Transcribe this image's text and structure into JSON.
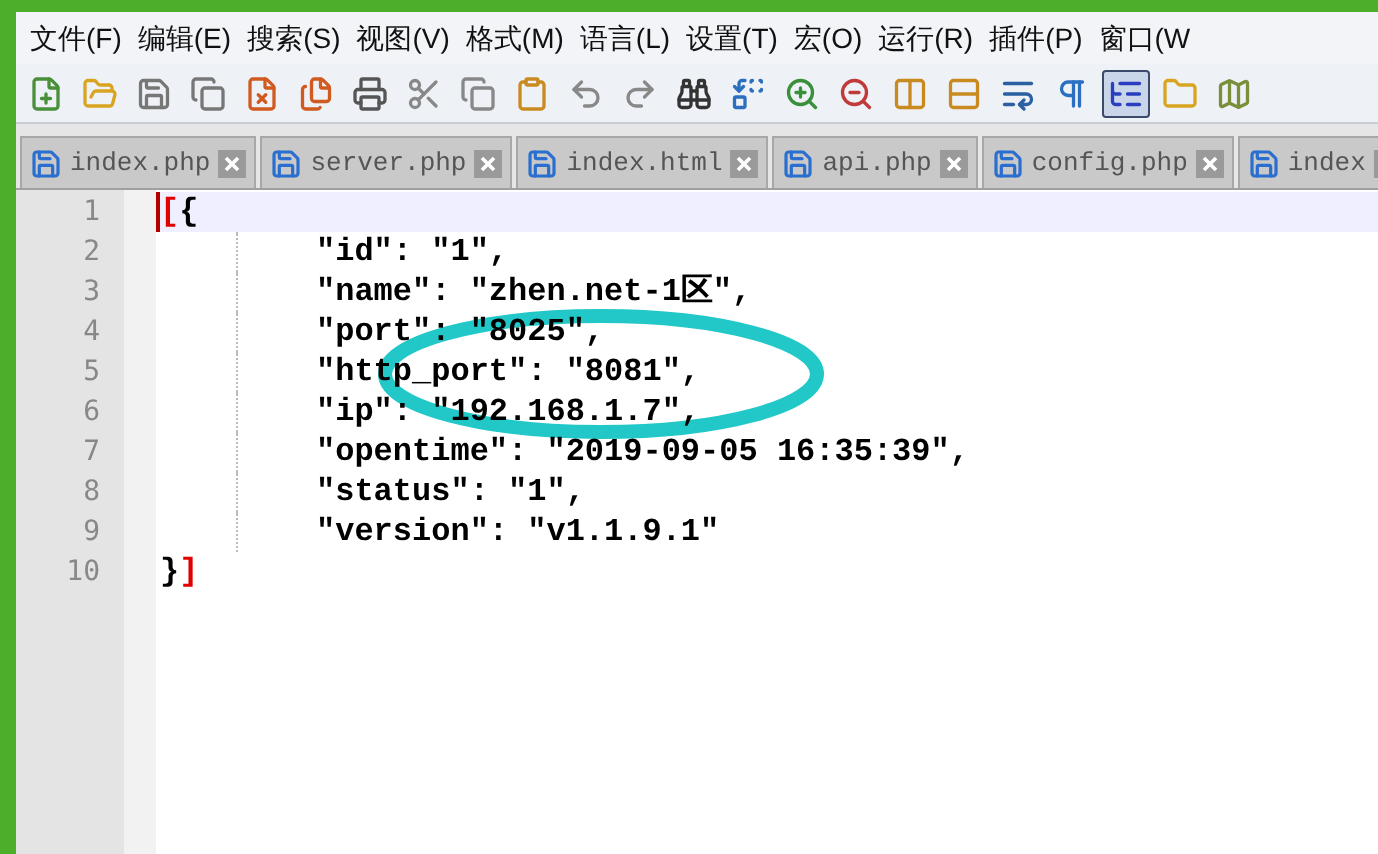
{
  "menu": [
    {
      "label": "文件(F)"
    },
    {
      "label": "编辑(E)"
    },
    {
      "label": "搜索(S)"
    },
    {
      "label": "视图(V)"
    },
    {
      "label": "格式(M)"
    },
    {
      "label": "语言(L)"
    },
    {
      "label": "设置(T)"
    },
    {
      "label": "宏(O)"
    },
    {
      "label": "运行(R)"
    },
    {
      "label": "插件(P)"
    },
    {
      "label": "窗口(W"
    }
  ],
  "toolbar": [
    {
      "kind": "new",
      "selected": false
    },
    {
      "kind": "open",
      "selected": false
    },
    {
      "kind": "save",
      "selected": false
    },
    {
      "kind": "save-all",
      "selected": false
    },
    {
      "kind": "close",
      "selected": false
    },
    {
      "kind": "close-all",
      "selected": false
    },
    {
      "kind": "print",
      "selected": false
    },
    {
      "kind": "cut",
      "selected": false
    },
    {
      "kind": "copy",
      "selected": false
    },
    {
      "kind": "paste",
      "selected": false
    },
    {
      "kind": "undo",
      "selected": false
    },
    {
      "kind": "redo",
      "selected": false
    },
    {
      "kind": "find",
      "selected": false
    },
    {
      "kind": "replace",
      "selected": false
    },
    {
      "kind": "zoom-in",
      "selected": false
    },
    {
      "kind": "zoom-out",
      "selected": false
    },
    {
      "kind": "sync-v",
      "selected": false
    },
    {
      "kind": "sync-h",
      "selected": false
    },
    {
      "kind": "wrap",
      "selected": false
    },
    {
      "kind": "pilcrow",
      "selected": false
    },
    {
      "kind": "indent-guide",
      "selected": true
    },
    {
      "kind": "folder",
      "selected": false
    },
    {
      "kind": "map",
      "selected": false
    }
  ],
  "tabs": [
    {
      "label": "index.php",
      "selected": false
    },
    {
      "label": "server.php",
      "selected": false
    },
    {
      "label": "index.html",
      "selected": false
    },
    {
      "label": "api.php",
      "selected": false
    },
    {
      "label": "config.php",
      "selected": false
    },
    {
      "label": "index",
      "selected": false
    }
  ],
  "editor": {
    "lines": [
      {
        "number": "1",
        "current": true,
        "indent": false,
        "segments": [
          {
            "text": "[",
            "kind": "match"
          },
          {
            "text": "{",
            "kind": "plain"
          }
        ]
      },
      {
        "number": "2",
        "current": false,
        "indent": true,
        "segments": [
          {
            "text": "\"id\": \"1\",",
            "kind": "plain"
          }
        ]
      },
      {
        "number": "3",
        "current": false,
        "indent": true,
        "segments": [
          {
            "text": "\"name\": \"zhen.net-1区\",",
            "kind": "plain"
          }
        ]
      },
      {
        "number": "4",
        "current": false,
        "indent": true,
        "segments": [
          {
            "text": "\"port\": \"8025\",",
            "kind": "plain"
          }
        ]
      },
      {
        "number": "5",
        "current": false,
        "indent": true,
        "segments": [
          {
            "text": "\"http_port\": \"8081\",",
            "kind": "plain"
          }
        ]
      },
      {
        "number": "6",
        "current": false,
        "indent": true,
        "segments": [
          {
            "text": "\"ip\": \"192.168.1.7\",",
            "kind": "plain"
          }
        ]
      },
      {
        "number": "7",
        "current": false,
        "indent": true,
        "segments": [
          {
            "text": "\"opentime\": \"2019-09-05 16:35:39\",",
            "kind": "plain"
          }
        ]
      },
      {
        "number": "8",
        "current": false,
        "indent": true,
        "segments": [
          {
            "text": "\"status\": \"1\",",
            "kind": "plain"
          }
        ]
      },
      {
        "number": "9",
        "current": false,
        "indent": true,
        "segments": [
          {
            "text": "\"version\": \"v1.1.9.1\"",
            "kind": "plain"
          }
        ]
      },
      {
        "number": "10",
        "current": false,
        "indent": false,
        "segments": [
          {
            "text": "}",
            "kind": "plain"
          },
          {
            "text": "]",
            "kind": "match"
          }
        ]
      }
    ]
  }
}
